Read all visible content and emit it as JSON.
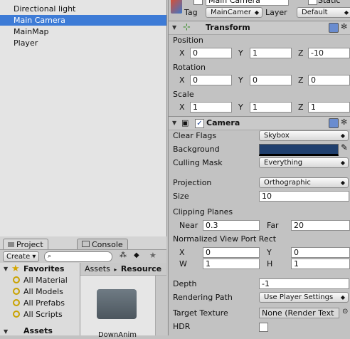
{
  "hierarchy": {
    "items": [
      {
        "label": "Directional light"
      },
      {
        "label": "Main Camera"
      },
      {
        "label": "MainMap"
      },
      {
        "label": "Player"
      }
    ]
  },
  "project_panel": {
    "tabs": {
      "project": "Project",
      "console": "Console"
    },
    "create_label": "Create ▾",
    "search_placeholder": "",
    "favorites_label": "Favorites",
    "favorites": [
      "All Material",
      "All Models",
      "All Prefabs",
      "All Scripts"
    ],
    "breadcrumb": {
      "root": "Assets",
      "sep": "▸",
      "current": "Resource"
    },
    "folder_label": "DownAnim",
    "assets_label": "Assets"
  },
  "inspector": {
    "object_name": "Main Camera",
    "static_label": "Static",
    "tag_label": "Tag",
    "tag_value": "MainCamer",
    "layer_label": "Layer",
    "layer_value": "Default",
    "transform": {
      "title": "Transform",
      "position_label": "Position",
      "position": {
        "x": "0",
        "y": "1",
        "z": "-10"
      },
      "rotation_label": "Rotation",
      "rotation": {
        "x": "0",
        "y": "0",
        "z": "0"
      },
      "scale_label": "Scale",
      "scale": {
        "x": "1",
        "y": "1",
        "z": "1"
      },
      "axis_x": "X",
      "axis_y": "Y",
      "axis_z": "Z"
    },
    "camera": {
      "title": "Camera",
      "clear_flags_label": "Clear Flags",
      "clear_flags_value": "Skybox",
      "background_label": "Background",
      "background_color": "#1f3f6e",
      "culling_mask_label": "Culling Mask",
      "culling_mask_value": "Everything",
      "projection_label": "Projection",
      "projection_value": "Orthographic",
      "size_label": "Size",
      "size_value": "10",
      "clipping_label": "Clipping Planes",
      "near_label": "Near",
      "near_value": "0.3",
      "far_label": "Far",
      "far_value": "20",
      "viewport_label": "Normalized View Port Rect",
      "vp_x_label": "X",
      "vp_x": "0",
      "vp_y_label": "Y",
      "vp_y": "0",
      "vp_w_label": "W",
      "vp_w": "1",
      "vp_h_label": "H",
      "vp_h": "1",
      "depth_label": "Depth",
      "depth_value": "-1",
      "rendering_path_label": "Rendering Path",
      "rendering_path_value": "Use Player Settings",
      "target_texture_label": "Target Texture",
      "target_texture_value": "None (Render Text",
      "hdr_label": "HDR"
    }
  },
  "colors": {
    "selection": "#3d7bd6",
    "panel": "#c2c2c2",
    "hierarchy_bg": "#e4e4e4"
  }
}
